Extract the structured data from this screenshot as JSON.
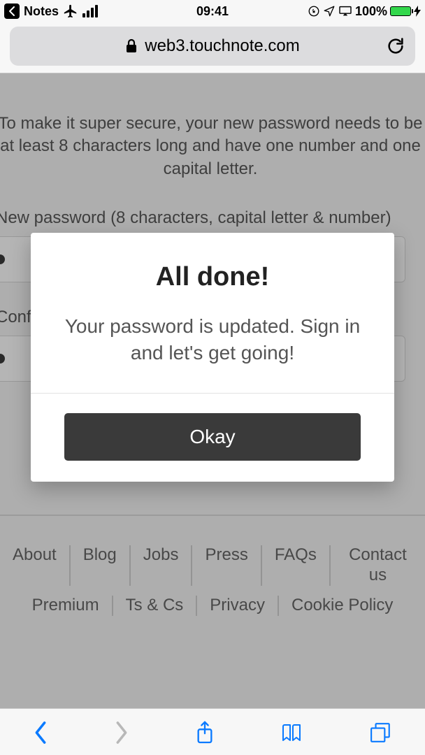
{
  "status": {
    "back_app": "Notes",
    "time": "09:41",
    "battery_pct": "100%"
  },
  "browser": {
    "url_display": "web3.touchnote.com"
  },
  "page": {
    "intro": "To make it super secure, your new password needs to be at least 8 characters long and have one number and one capital letter.",
    "new_pw_label": "New password (8 characters, capital letter & number)",
    "confirm_label": "Confirm password"
  },
  "modal": {
    "title": "All done!",
    "body": "Your password is updated. Sign in and let's get going!",
    "okay": "Okay"
  },
  "footer": {
    "row1": [
      "About",
      "Blog",
      "Jobs",
      "Press",
      "FAQs",
      "Contact us"
    ],
    "row2": [
      "Premium",
      "Ts & Cs",
      "Privacy",
      "Cookie Policy"
    ]
  }
}
